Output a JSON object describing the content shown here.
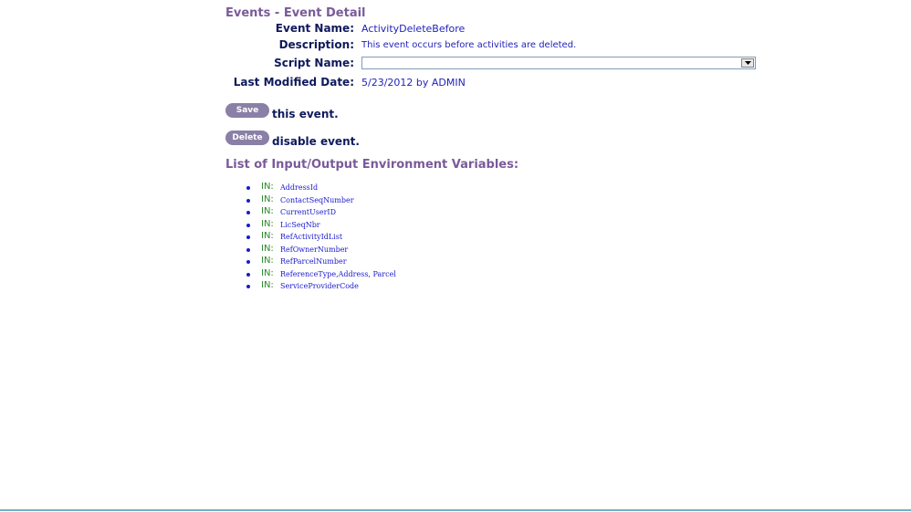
{
  "page": {
    "title": "Events - Event Detail"
  },
  "fields": {
    "event_name_label": "Event Name:",
    "event_name_value": "ActivityDeleteBefore",
    "description_label": "Description:",
    "description_value": "This event occurs before activities are deleted.",
    "script_name_label": "Script Name:",
    "script_name_value": "",
    "last_modified_label": "Last Modified Date:",
    "last_modified_value": "5/23/2012 by ADMIN"
  },
  "actions": {
    "save_label": "Save",
    "save_text": "this event.",
    "delete_label": "Delete",
    "delete_text": "disable event."
  },
  "variables": {
    "title": "List of Input/Output Environment Variables:",
    "items": [
      {
        "dir": "IN:",
        "name": "AddressId"
      },
      {
        "dir": "IN:",
        "name": "ContactSeqNumber"
      },
      {
        "dir": "IN:",
        "name": "CurrentUserID"
      },
      {
        "dir": "IN:",
        "name": "LicSeqNbr"
      },
      {
        "dir": "IN:",
        "name": "RefActivityIdList"
      },
      {
        "dir": "IN:",
        "name": "RefOwnerNumber"
      },
      {
        "dir": "IN:",
        "name": "RefParcelNumber"
      },
      {
        "dir": "IN:",
        "name": "ReferenceType,Address, Parcel"
      },
      {
        "dir": "IN:",
        "name": "ServiceProviderCode"
      }
    ]
  },
  "colors": {
    "title": "#7a5a9a",
    "label": "#0e1a5c",
    "value": "#2222bb",
    "button": "#8a7fa6",
    "in_label": "#2a8a2a",
    "bottom_rule": "#6fb3c8"
  },
  "icons": {
    "select_arrow": "chevron-down-icon",
    "list_bullet": "bullet-icon"
  }
}
